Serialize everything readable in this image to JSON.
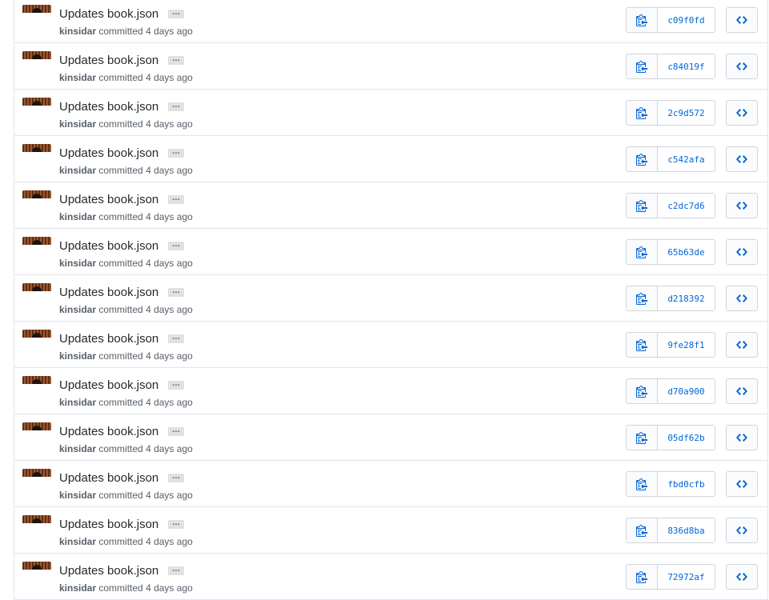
{
  "colors": {
    "link": "#0366d6",
    "text": "#24292e",
    "muted": "#586069",
    "border": "#e1e4e8"
  },
  "icons": {
    "copy": "clippy-icon",
    "browse": "code-icon"
  },
  "commits": [
    {
      "title": "Updates book.json",
      "ellipsis": "…",
      "author": "kinsidar",
      "action": "committed",
      "time": "4 days ago",
      "sha": "c09f0fd"
    },
    {
      "title": "Updates book.json",
      "ellipsis": "…",
      "author": "kinsidar",
      "action": "committed",
      "time": "4 days ago",
      "sha": "c84019f"
    },
    {
      "title": "Updates book.json",
      "ellipsis": "…",
      "author": "kinsidar",
      "action": "committed",
      "time": "4 days ago",
      "sha": "2c9d572"
    },
    {
      "title": "Updates book.json",
      "ellipsis": "…",
      "author": "kinsidar",
      "action": "committed",
      "time": "4 days ago",
      "sha": "c542afa"
    },
    {
      "title": "Updates book.json",
      "ellipsis": "…",
      "author": "kinsidar",
      "action": "committed",
      "time": "4 days ago",
      "sha": "c2dc7d6"
    },
    {
      "title": "Updates book.json",
      "ellipsis": "…",
      "author": "kinsidar",
      "action": "committed",
      "time": "4 days ago",
      "sha": "65b63de"
    },
    {
      "title": "Updates book.json",
      "ellipsis": "…",
      "author": "kinsidar",
      "action": "committed",
      "time": "4 days ago",
      "sha": "d218392"
    },
    {
      "title": "Updates book.json",
      "ellipsis": "…",
      "author": "kinsidar",
      "action": "committed",
      "time": "4 days ago",
      "sha": "9fe28f1"
    },
    {
      "title": "Updates book.json",
      "ellipsis": "…",
      "author": "kinsidar",
      "action": "committed",
      "time": "4 days ago",
      "sha": "d70a900"
    },
    {
      "title": "Updates book.json",
      "ellipsis": "…",
      "author": "kinsidar",
      "action": "committed",
      "time": "4 days ago",
      "sha": "05df62b"
    },
    {
      "title": "Updates book.json",
      "ellipsis": "…",
      "author": "kinsidar",
      "action": "committed",
      "time": "4 days ago",
      "sha": "fbd0cfb"
    },
    {
      "title": "Updates book.json",
      "ellipsis": "…",
      "author": "kinsidar",
      "action": "committed",
      "time": "4 days ago",
      "sha": "836d8ba"
    },
    {
      "title": "Updates book.json",
      "ellipsis": "…",
      "author": "kinsidar",
      "action": "committed",
      "time": "4 days ago",
      "sha": "72972af"
    }
  ]
}
